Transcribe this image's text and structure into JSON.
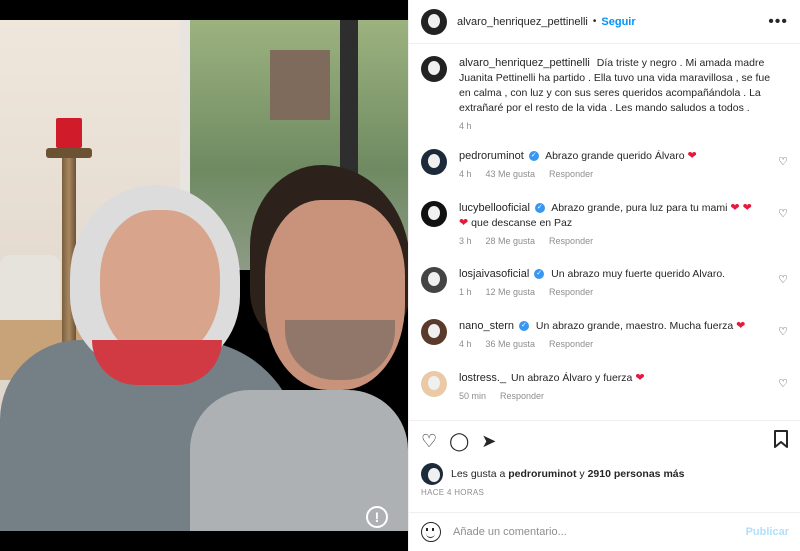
{
  "header": {
    "username": "alvaro_henriquez_pettinelli",
    "separator": "•",
    "follow_label": "Seguir",
    "more_icon": "more-horizontal-icon"
  },
  "caption": {
    "username": "alvaro_henriquez_pettinelli",
    "text": "Día triste y negro . Mi amada madre Juanita Pettinelli ha partido . Ella tuvo una vida maravillosa , se fue en calma , con luz y con sus seres queridos acompañándola . La extrañaré por el resto de la vida . Les mando saludos a todos .",
    "time": "4 h"
  },
  "comments": [
    {
      "username": "pedroruminot",
      "verified": true,
      "text": "Abrazo grande querido Álvaro",
      "heart": "❤",
      "time": "4 h",
      "likes": "43 Me gusta",
      "reply": "Responder"
    },
    {
      "username": "lucybellooficial",
      "verified": true,
      "text": "Abrazo grande, pura luz para tu mami",
      "heart": "❤ ❤",
      "text2": "que descanse en Paz",
      "heart2": "❤",
      "time": "3 h",
      "likes": "28 Me gusta",
      "reply": "Responder"
    },
    {
      "username": "losjaivasoficial",
      "verified": true,
      "text": "Un abrazo muy fuerte querido Alvaro.",
      "time": "1 h",
      "likes": "12 Me gusta",
      "reply": "Responder"
    },
    {
      "username": "nano_stern",
      "verified": true,
      "text": "Un abrazo grande, maestro. Mucha fuerza",
      "heart": "❤",
      "time": "4 h",
      "likes": "36 Me gusta",
      "reply": "Responder"
    },
    {
      "username": "lostress._",
      "verified": false,
      "text": "Un abrazo Álvaro y fuerza",
      "heart": "❤",
      "time": "50 min",
      "reply": "Responder"
    }
  ],
  "likes": {
    "prefix": "Les gusta a",
    "user": "pedroruminot",
    "middle": "y",
    "count": "2910 personas más"
  },
  "timestamp": "HACE 4 HORAS",
  "add_comment": {
    "placeholder": "Añade un comentario...",
    "publish_label": "Publicar"
  },
  "photo": {
    "info_icon": "!"
  }
}
